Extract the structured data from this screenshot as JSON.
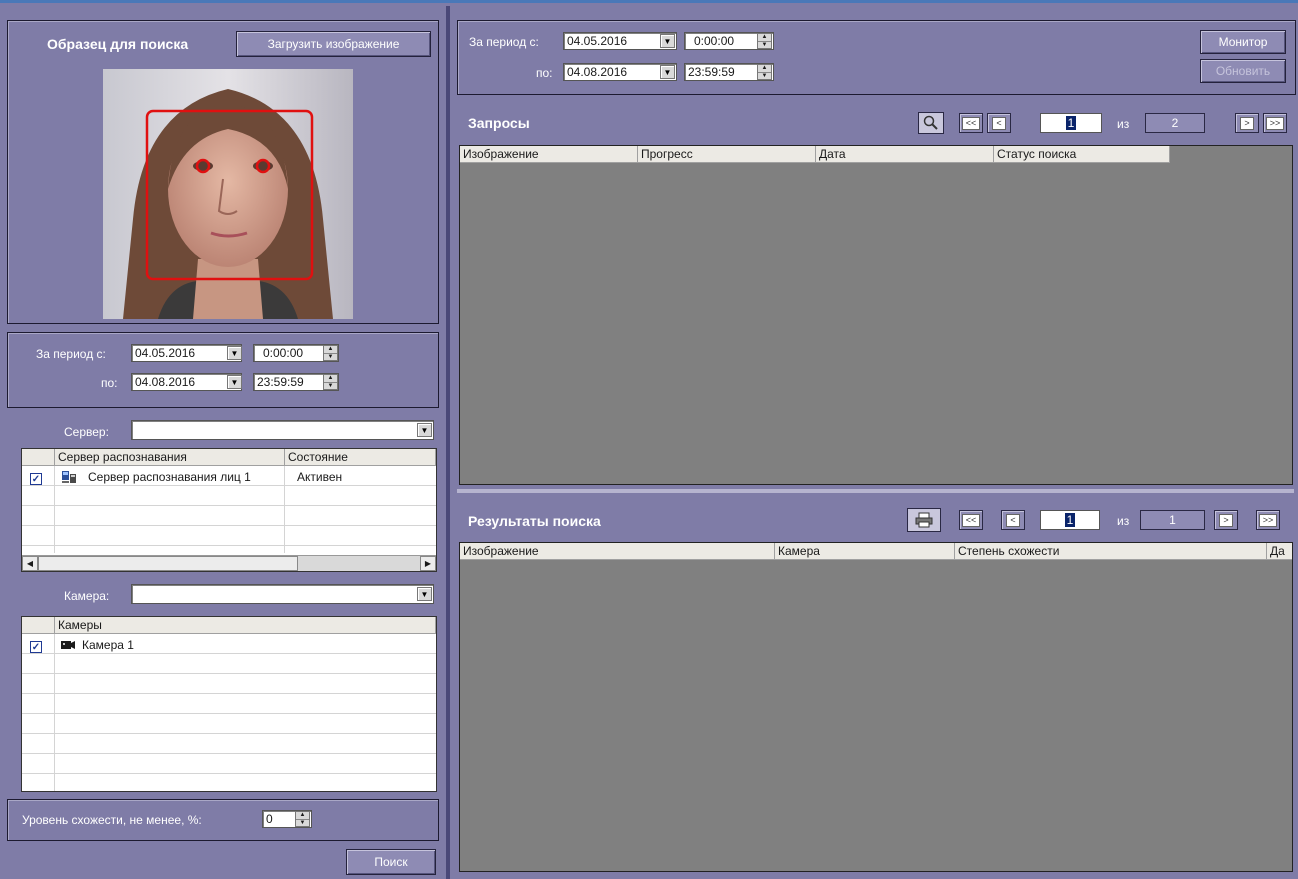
{
  "sample": {
    "title": "Образец для поиска",
    "upload_label": "Загрузить изображение"
  },
  "left_period": {
    "from_label": "За период с:",
    "from_date": "04.05.2016",
    "from_time": "0:00:00",
    "to_label": "по:",
    "to_date": "04.08.2016",
    "to_time": "23:59:59"
  },
  "server": {
    "label": "Сервер:",
    "value": "",
    "columns": [
      "Сервер распознавания",
      "Состояние"
    ],
    "rows": [
      {
        "checked": true,
        "name": "Сервер распознавания лиц 1",
        "state": "Активен"
      }
    ]
  },
  "camera": {
    "label": "Камера:",
    "value": "",
    "column": "Камеры",
    "rows": [
      {
        "checked": true,
        "name": "Камера 1"
      }
    ]
  },
  "similarity": {
    "label": "Уровень схожести, не менее, %:",
    "value": "0"
  },
  "search_label": "Поиск",
  "right_period": {
    "from_label": "За период с:",
    "from_date": "04.05.2016",
    "from_time": "0:00:00",
    "to_label": "по:",
    "to_date": "04.08.2016",
    "to_time": "23:59:59",
    "monitor_label": "Монитор",
    "refresh_label": "Обновить"
  },
  "queries": {
    "title": "Запросы",
    "columns": [
      "Изображение",
      "Прогресс",
      "Дата",
      "Статус поиска"
    ],
    "pager": {
      "first": "<<",
      "prev": "<",
      "page": "1",
      "of": "из",
      "total": "2",
      "next": ">",
      "last": ">>"
    }
  },
  "results": {
    "title": "Результаты поиска",
    "columns": [
      "Изображение",
      "Камера",
      "Степень схожести",
      "Да"
    ],
    "pager": {
      "first": "<<",
      "prev": "<",
      "page": "1",
      "of": "из",
      "total": "1",
      "next": ">",
      "last": ">>"
    }
  },
  "colors": {
    "panel_bg": "#7f7ca7",
    "grid_bg": "#808080",
    "face_box": "#e01010"
  }
}
